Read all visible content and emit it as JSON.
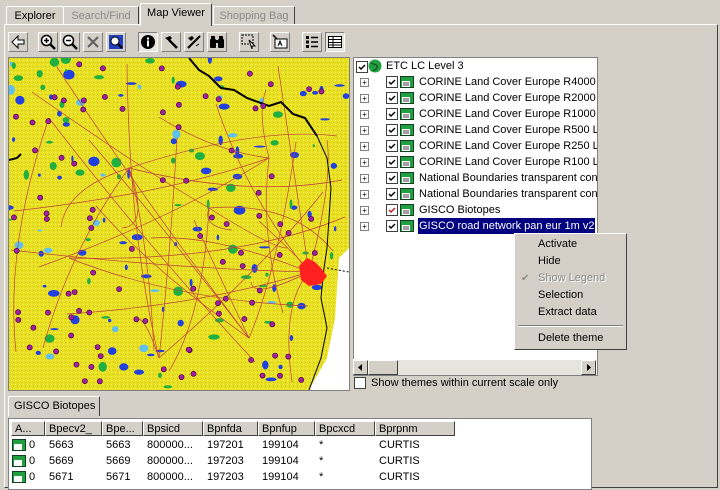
{
  "tabs": [
    {
      "label": "Explorer",
      "state": "normal"
    },
    {
      "label": "Search/Find",
      "state": "disabled"
    },
    {
      "label": "Map Viewer",
      "state": "active"
    },
    {
      "label": "Shopping Bag",
      "state": "disabled"
    }
  ],
  "toolbar": {
    "icons": [
      "back-arrow-icon",
      "zoom-in-icon",
      "zoom-out-icon",
      "clear-icon",
      "zoom-extent-icon",
      "identify-icon",
      "hammer-icon",
      "measure-icon",
      "binoculars-icon",
      "select-icon",
      "label-icon",
      "legend-view-icon",
      "table-view-icon"
    ]
  },
  "legend": {
    "root_label": "ETC LC Level 3",
    "themes": [
      {
        "label": "CORINE Land Cover Europe R4000",
        "checked": true
      },
      {
        "label": "CORINE Land Cover Europe R2000",
        "checked": true
      },
      {
        "label": "CORINE Land Cover Europe R1000",
        "checked": true
      },
      {
        "label": "CORINE Land Cover Europe R500 L",
        "checked": true
      },
      {
        "label": "CORINE Land Cover Europe R250 L",
        "checked": true
      },
      {
        "label": "CORINE Land Cover Europe R100 L",
        "checked": true
      },
      {
        "label": "National Boundaries transparent con",
        "checked": true
      },
      {
        "label": "National Boundaries transparent con",
        "checked": true
      },
      {
        "label": "GISCO Biotopes",
        "checked": true
      },
      {
        "label": "GISCO road network pan eur 1m v2",
        "checked": true,
        "selected": true
      }
    ],
    "show_scale_label": "Show themes within current scale only"
  },
  "context_menu": {
    "items": [
      {
        "label": "Activate",
        "enabled": true
      },
      {
        "label": "Hide",
        "enabled": true
      },
      {
        "label": "Show Legend",
        "enabled": false,
        "checked": true
      },
      {
        "label": "Selection",
        "enabled": true
      },
      {
        "label": "Extract data",
        "enabled": true
      },
      {
        "label": "Delete theme",
        "enabled": true
      }
    ]
  },
  "table": {
    "tab_label": "GISCO Biotopes",
    "columns": [
      "A...",
      "Bpecv2_",
      "Bpe...",
      "Bpsicd",
      "Bpnfda",
      "Bpnfup",
      "Bpcxcd",
      "Bprpnm"
    ],
    "rows": [
      [
        "0",
        "5663",
        "5663",
        "800000...",
        "197201",
        "199104",
        "*",
        "CURTIS"
      ],
      [
        "0",
        "5669",
        "5669",
        "800000...",
        "197203",
        "199104",
        "*",
        "CURTIS"
      ],
      [
        "0",
        "5671",
        "5671",
        "800000...",
        "197203",
        "199104",
        "*",
        "CURTIS"
      ]
    ]
  },
  "colors": {
    "map_land": "#e8e020",
    "map_water": "#2040e0",
    "map_forest": "#20b040",
    "map_urban": "#ff2020",
    "biotope_points": "#a020a0",
    "selection": "#000080"
  }
}
